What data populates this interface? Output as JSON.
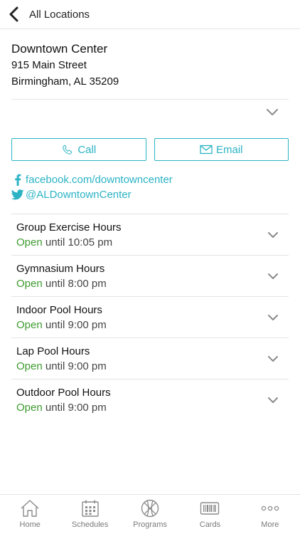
{
  "header": {
    "back_label": "All Locations"
  },
  "location": {
    "name": "Downtown Center",
    "street": "915 Main Street",
    "city_line": "Birmingham, AL 35209"
  },
  "contact": {
    "call_label": "Call",
    "email_label": "Email"
  },
  "social": {
    "facebook": "facebook.com/downtowncenter",
    "twitter": "@ALDowntownCenter"
  },
  "hours": [
    {
      "title": "Group Exercise Hours",
      "status": "Open",
      "until": " until 10:05 pm"
    },
    {
      "title": "Gymnasium Hours",
      "status": "Open",
      "until": " until 8:00 pm"
    },
    {
      "title": "Indoor Pool Hours",
      "status": "Open",
      "until": " until 9:00 pm"
    },
    {
      "title": "Lap Pool Hours",
      "status": "Open",
      "until": " until 9:00 pm"
    },
    {
      "title": "Outdoor Pool Hours",
      "status": "Open",
      "until": " until 9:00 pm"
    }
  ],
  "tabs": [
    {
      "label": "Home",
      "icon": "home-icon"
    },
    {
      "label": "Schedules",
      "icon": "calendar-icon"
    },
    {
      "label": "Programs",
      "icon": "basketball-icon"
    },
    {
      "label": "Cards",
      "icon": "barcode-card-icon"
    },
    {
      "label": "More",
      "icon": "more-dots-icon"
    }
  ],
  "colors": {
    "accent": "#2bb3c4",
    "open": "#3e9b2f",
    "divider": "#e3e3e3",
    "icon_gray": "#8a8a8a"
  }
}
